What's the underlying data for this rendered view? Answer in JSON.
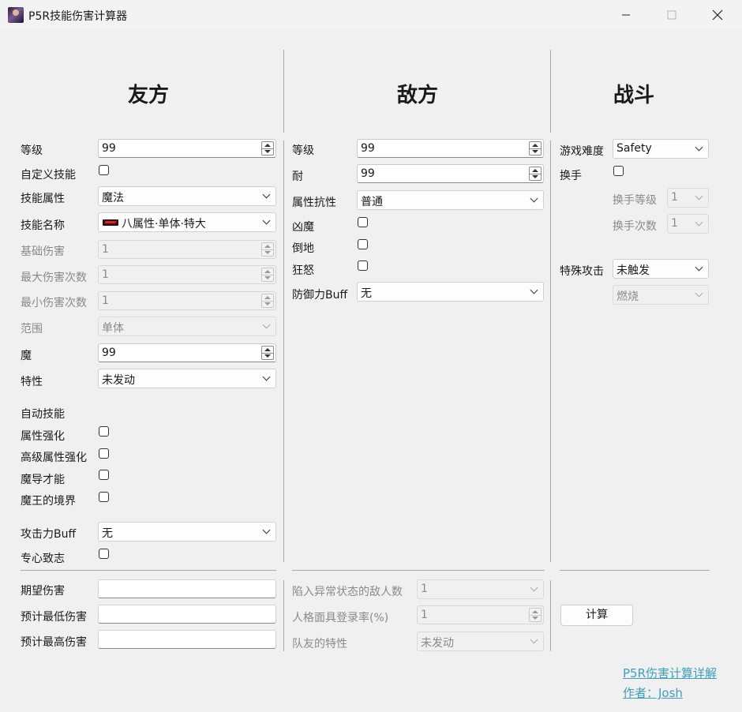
{
  "window": {
    "title": "P5R技能伤害计算器"
  },
  "sections": {
    "ally": "友方",
    "enemy": "敌方",
    "battle": "战斗"
  },
  "ally": {
    "level_label": "等级",
    "level_value": "99",
    "custom_skill_label": "自定义技能",
    "skill_attr_label": "技能属性",
    "skill_attr_value": "魔法",
    "skill_name_label": "技能名称",
    "skill_name_value": "八属性·单体·特大",
    "base_damage_label": "基础伤害",
    "base_damage_value": "1",
    "max_hits_label": "最大伤害次数",
    "max_hits_value": "1",
    "min_hits_label": "最小伤害次数",
    "min_hits_value": "1",
    "range_label": "范围",
    "range_value": "单体",
    "magic_label": "魔",
    "magic_value": "99",
    "trait_label": "特性",
    "trait_value": "未发动",
    "auto_skill_label": "自动技能",
    "attr_boost_label": "属性强化",
    "adv_attr_boost_label": "高级属性强化",
    "magic_ability_label": "魔导才能",
    "demon_realm_label": "魔王的境界",
    "atk_buff_label": "攻击力Buff",
    "atk_buff_value": "无",
    "concentrate_label": "专心致志"
  },
  "enemy": {
    "level_label": "等级",
    "level_value": "99",
    "endurance_label": "耐",
    "endurance_value": "99",
    "resist_label": "属性抗性",
    "resist_value": "普通",
    "ominous_label": "凶魔",
    "down_label": "倒地",
    "rage_label": "狂怒",
    "def_buff_label": "防御力Buff",
    "def_buff_value": "无"
  },
  "battle": {
    "difficulty_label": "游戏难度",
    "difficulty_value": "Safety",
    "switch_label": "换手",
    "switch_level_label": "换手等级",
    "switch_level_value": "1",
    "switch_count_label": "换手次数",
    "switch_count_value": "1",
    "special_attack_label": "特殊攻击",
    "special_attack_value": "未触发",
    "special_sub_value": "燃烧"
  },
  "results": {
    "expected_label": "期望伤害",
    "expected_value": "",
    "min_label": "预计最低伤害",
    "min_value": "",
    "max_label": "预计最高伤害",
    "max_value": ""
  },
  "extra": {
    "abnormal_enemies_label": "陷入异常状态的敌人数",
    "abnormal_enemies_value": "1",
    "persona_rate_label": "人格面具登录率(%)",
    "persona_rate_value": "1",
    "teammate_trait_label": "队友的特性",
    "teammate_trait_value": "未发动"
  },
  "actions": {
    "calculate_label": "计算"
  },
  "footer": {
    "details_link": "P5R伤害计算详解",
    "author": "作者：Josh"
  },
  "colors": {
    "link": "#3c9fbd",
    "background": "#f0f0f0"
  }
}
